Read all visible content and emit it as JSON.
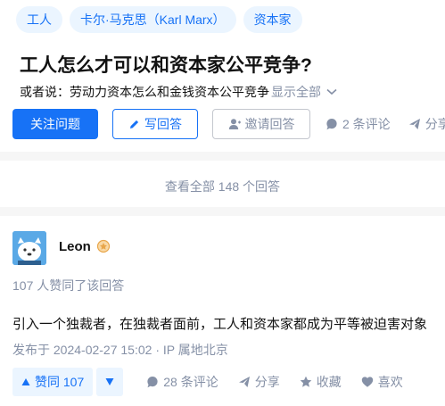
{
  "question": {
    "topics": [
      "工人",
      "卡尔·马克思（Karl Marx）",
      "资本家"
    ],
    "title": "工人怎么才可以和资本家公平竞争?",
    "detail": "或者说：劳动力资本怎么和金钱资本公平竞争",
    "expand_label": "显示全部",
    "follow_label": "关注问题",
    "write_answer_label": "写回答",
    "invite_label": "邀请回答",
    "comments_label": "2 条评论",
    "share_label": "分享"
  },
  "view_all_label": "查看全部 148 个回答",
  "answer": {
    "author": "Leon",
    "upvote_summary": "107 人赞同了该回答",
    "content": "引入一个独裁者，在独裁者面前，工人和资本家都成为平等被迫害对象",
    "publish_time": "发布于 2024-02-27 15:02 · IP 属地北京",
    "vote_label": "赞同 107",
    "comments_label": "28 条评论",
    "share_label": "分享",
    "favorite_label": "收藏",
    "like_label": "喜欢"
  },
  "colors": {
    "brand_blue": "#1772f6",
    "tag_bg": "#ebf5ff",
    "meta_gray": "#8590a6"
  }
}
